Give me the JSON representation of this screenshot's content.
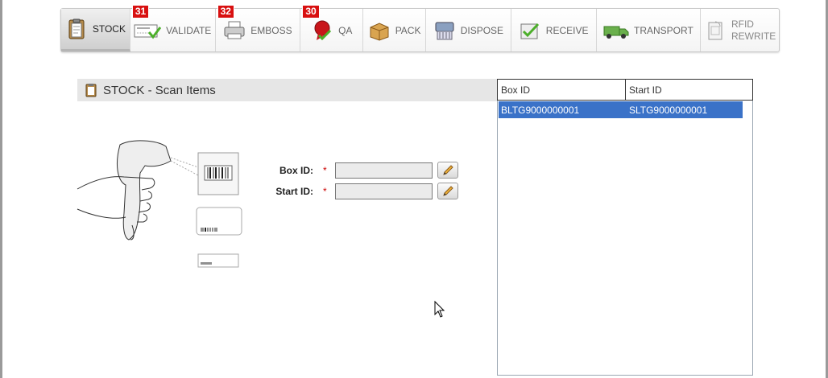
{
  "toolbar": {
    "items": [
      {
        "label": "STOCK",
        "active": true,
        "badge": null,
        "icon": "clipboard-icon"
      },
      {
        "label": "VALIDATE",
        "active": false,
        "badge": "31",
        "icon": "card-check-icon"
      },
      {
        "label": "EMBOSS",
        "active": false,
        "badge": "32",
        "icon": "printer-icon"
      },
      {
        "label": "QA",
        "active": false,
        "badge": "30",
        "icon": "rosette-check-icon"
      },
      {
        "label": "PACK",
        "active": false,
        "badge": null,
        "icon": "box-icon"
      },
      {
        "label": "DISPOSE",
        "active": false,
        "badge": null,
        "icon": "shredder-icon"
      },
      {
        "label": "RECEIVE",
        "active": false,
        "badge": null,
        "icon": "receive-check-icon"
      },
      {
        "label": "TRANSPORT",
        "active": false,
        "badge": null,
        "icon": "truck-icon"
      },
      {
        "label": "RFID",
        "label2": "REWRITE",
        "active": false,
        "badge": null,
        "icon": "rfid-icon"
      }
    ]
  },
  "panel": {
    "title": "STOCK - Scan Items"
  },
  "form": {
    "box_id_label": "Box ID:",
    "start_id_label": "Start ID:",
    "required_mark": "*",
    "box_id_value": "",
    "start_id_value": ""
  },
  "grid": {
    "columns": [
      "Box ID",
      "Start ID"
    ],
    "rows": [
      [
        "BLTG9000000001",
        "SLTG9000000001"
      ]
    ],
    "selected_color": "#3a72c8"
  }
}
